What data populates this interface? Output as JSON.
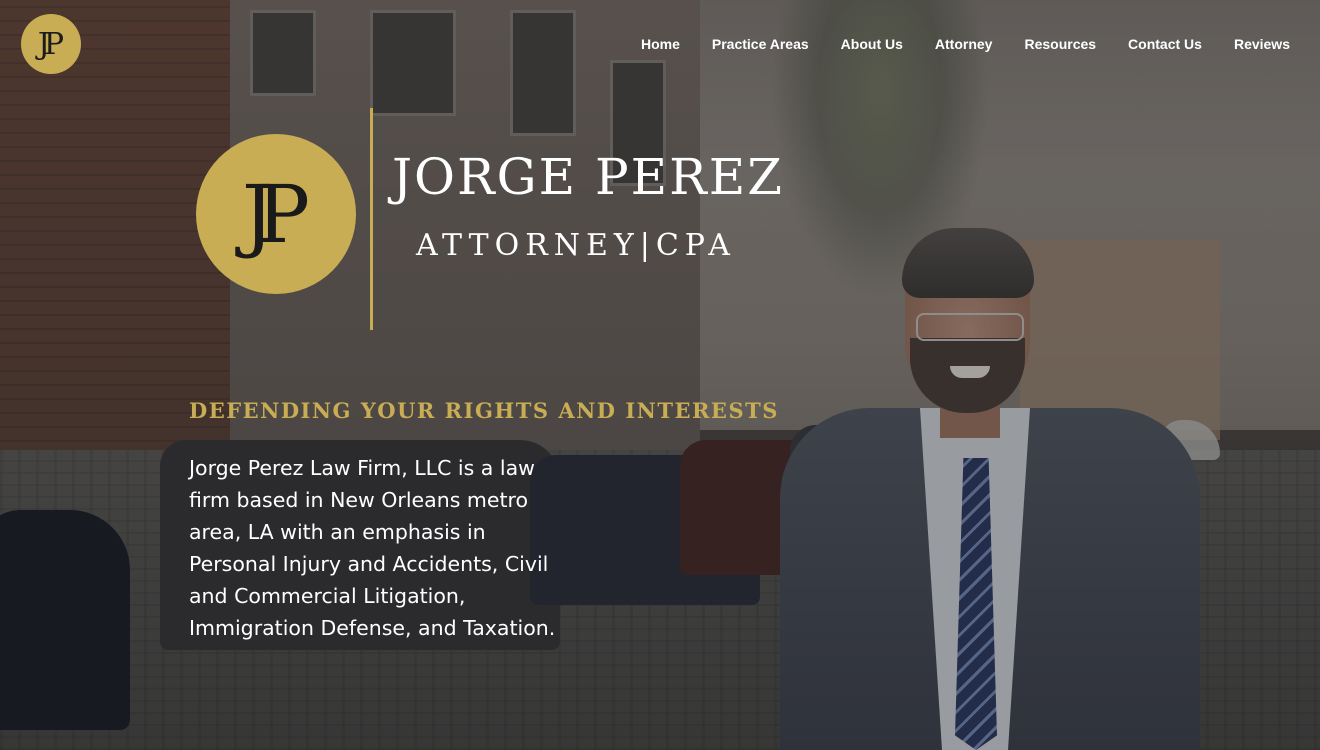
{
  "header": {
    "logo_monogram": "JP",
    "nav": [
      {
        "label": "Home"
      },
      {
        "label": "Practice Areas"
      },
      {
        "label": "About Us"
      },
      {
        "label": "Attorney"
      },
      {
        "label": "Resources"
      },
      {
        "label": "Contact Us"
      },
      {
        "label": "Reviews"
      }
    ]
  },
  "hero": {
    "brand_monogram": "JP",
    "brand_name": "JORGE PEREZ",
    "brand_subtitle": "ATTORNEY|CPA",
    "tagline": "DEFENDING YOUR RIGHTS AND INTERESTS",
    "description": "Jorge Perez Law Firm, LLC is a law firm based in New Orleans metro area, LA with an emphasis in Personal Injury and Accidents, Civil and Commercial Litigation, Immigration Defense, and Taxation."
  },
  "colors": {
    "gold": "#c9ad54",
    "text": "#ffffff"
  }
}
